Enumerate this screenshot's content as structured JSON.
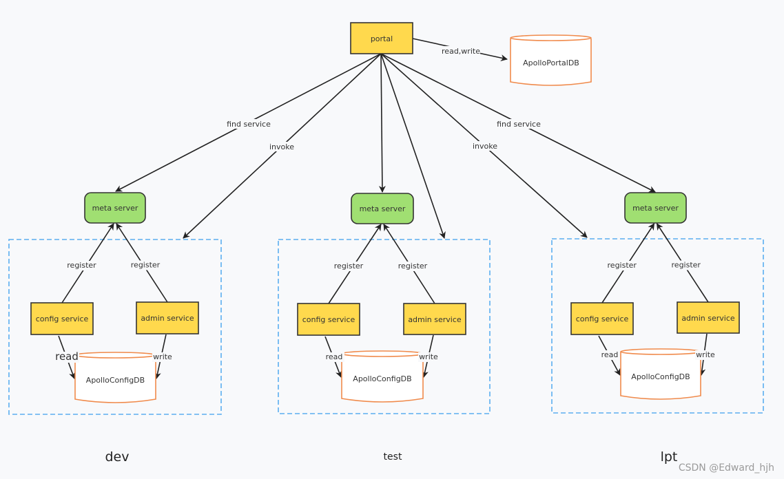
{
  "colors": {
    "background": "#f8f9fb",
    "service_fill": "#ffd94d",
    "meta_fill": "#a0df72",
    "db_stroke": "#f08a4b",
    "group_border": "#5aaef0",
    "line": "#222222"
  },
  "portal": {
    "label": "portal"
  },
  "portal_db": {
    "label": "ApolloPortalDB",
    "edge_label": "read,write"
  },
  "edge_labels": {
    "find_service": "find service",
    "invoke": "invoke"
  },
  "environments": [
    {
      "name": "dev",
      "meta": "meta server",
      "config": "config service",
      "admin": "admin service",
      "db": "ApolloConfigDB",
      "register_left": "register",
      "register_right": "register",
      "read": "read",
      "write": "write"
    },
    {
      "name": "test",
      "meta": "meta server",
      "config": "config service",
      "admin": "admin service",
      "db": "ApolloConfigDB",
      "register_left": "register",
      "register_right": "register",
      "read": "read",
      "write": "write"
    },
    {
      "name": "lpt",
      "meta": "meta server",
      "config": "config service",
      "admin": "admin service",
      "db": "ApolloConfigDB",
      "register_left": "register",
      "register_right": "register",
      "read": "read",
      "write": "write"
    }
  ],
  "watermark": "CSDN @Edward_hjh"
}
